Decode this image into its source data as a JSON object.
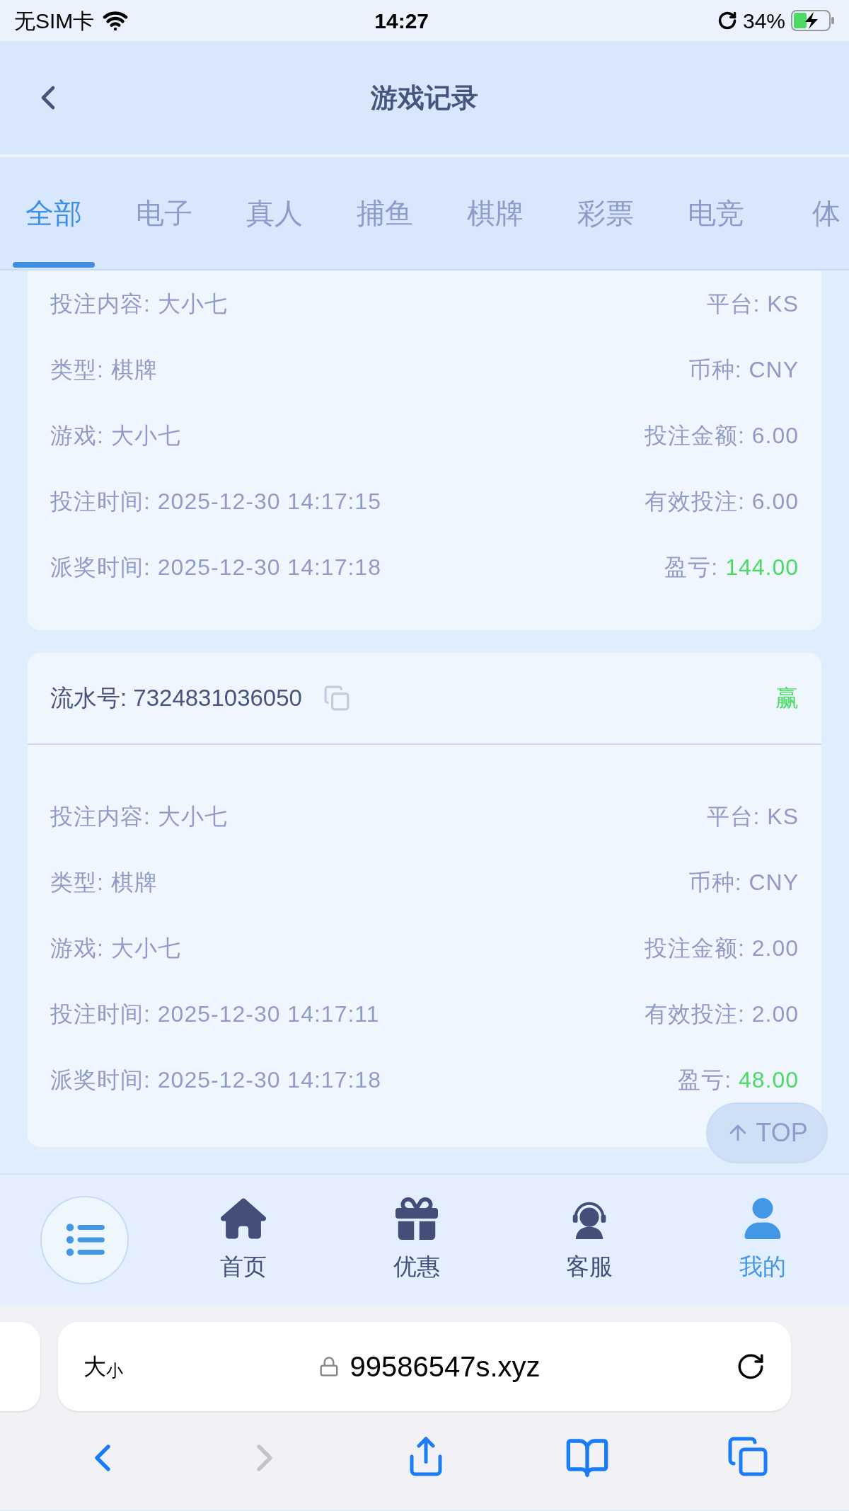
{
  "status_bar": {
    "carrier": "无SIM卡",
    "time": "14:27",
    "battery": "34%"
  },
  "header": {
    "title": "游戏记录"
  },
  "tabs": [
    {
      "label": "全部",
      "selected": true
    },
    {
      "label": "电子",
      "selected": false
    },
    {
      "label": "真人",
      "selected": false
    },
    {
      "label": "捕鱼",
      "selected": false
    },
    {
      "label": "棋牌",
      "selected": false
    },
    {
      "label": "彩票",
      "selected": false
    },
    {
      "label": "电竞",
      "selected": false
    },
    {
      "label": "体",
      "selected": false
    }
  ],
  "records": [
    {
      "rows": [
        {
          "left": "投注内容: 大小七",
          "right_label": "平台: ",
          "right_value": "KS",
          "highlight": false
        },
        {
          "left": "类型: 棋牌",
          "right_label": "币种: ",
          "right_value": "CNY",
          "highlight": false
        },
        {
          "left": "游戏: 大小七",
          "right_label": "投注金额: ",
          "right_value": "6.00",
          "highlight": false
        },
        {
          "left": "投注时间: 2025-12-30 14:17:15",
          "right_label": "有效投注: ",
          "right_value": "6.00",
          "highlight": false
        },
        {
          "left": "派奖时间: 2025-12-30 14:17:18",
          "right_label": "盈亏: ",
          "right_value": "144.00",
          "highlight": true
        }
      ]
    },
    {
      "serial": "流水号: 7324831036050",
      "result": "赢",
      "rows": [
        {
          "left": "投注内容: 大小七",
          "right_label": "平台: ",
          "right_value": "KS",
          "highlight": false
        },
        {
          "left": "类型: 棋牌",
          "right_label": "币种: ",
          "right_value": "CNY",
          "highlight": false
        },
        {
          "left": "游戏: 大小七",
          "right_label": "投注金额: ",
          "right_value": "2.00",
          "highlight": false
        },
        {
          "left": "投注时间: 2025-12-30 14:17:11",
          "right_label": "有效投注: ",
          "right_value": "2.00",
          "highlight": false
        },
        {
          "left": "派奖时间: 2025-12-30 14:17:18",
          "right_label": "盈亏: ",
          "right_value": "48.00",
          "highlight": true
        }
      ]
    }
  ],
  "top_button": {
    "label": "TOP"
  },
  "bottom_nav": [
    {
      "kind": "home",
      "label": "首页",
      "selected": false
    },
    {
      "kind": "gift",
      "label": "优惠",
      "selected": false
    },
    {
      "kind": "service",
      "label": "客服",
      "selected": false
    },
    {
      "kind": "user",
      "label": "我的",
      "selected": true
    }
  ],
  "browser": {
    "text_size_large": "大",
    "text_size_small": "小",
    "url": "99586547s.xyz"
  }
}
